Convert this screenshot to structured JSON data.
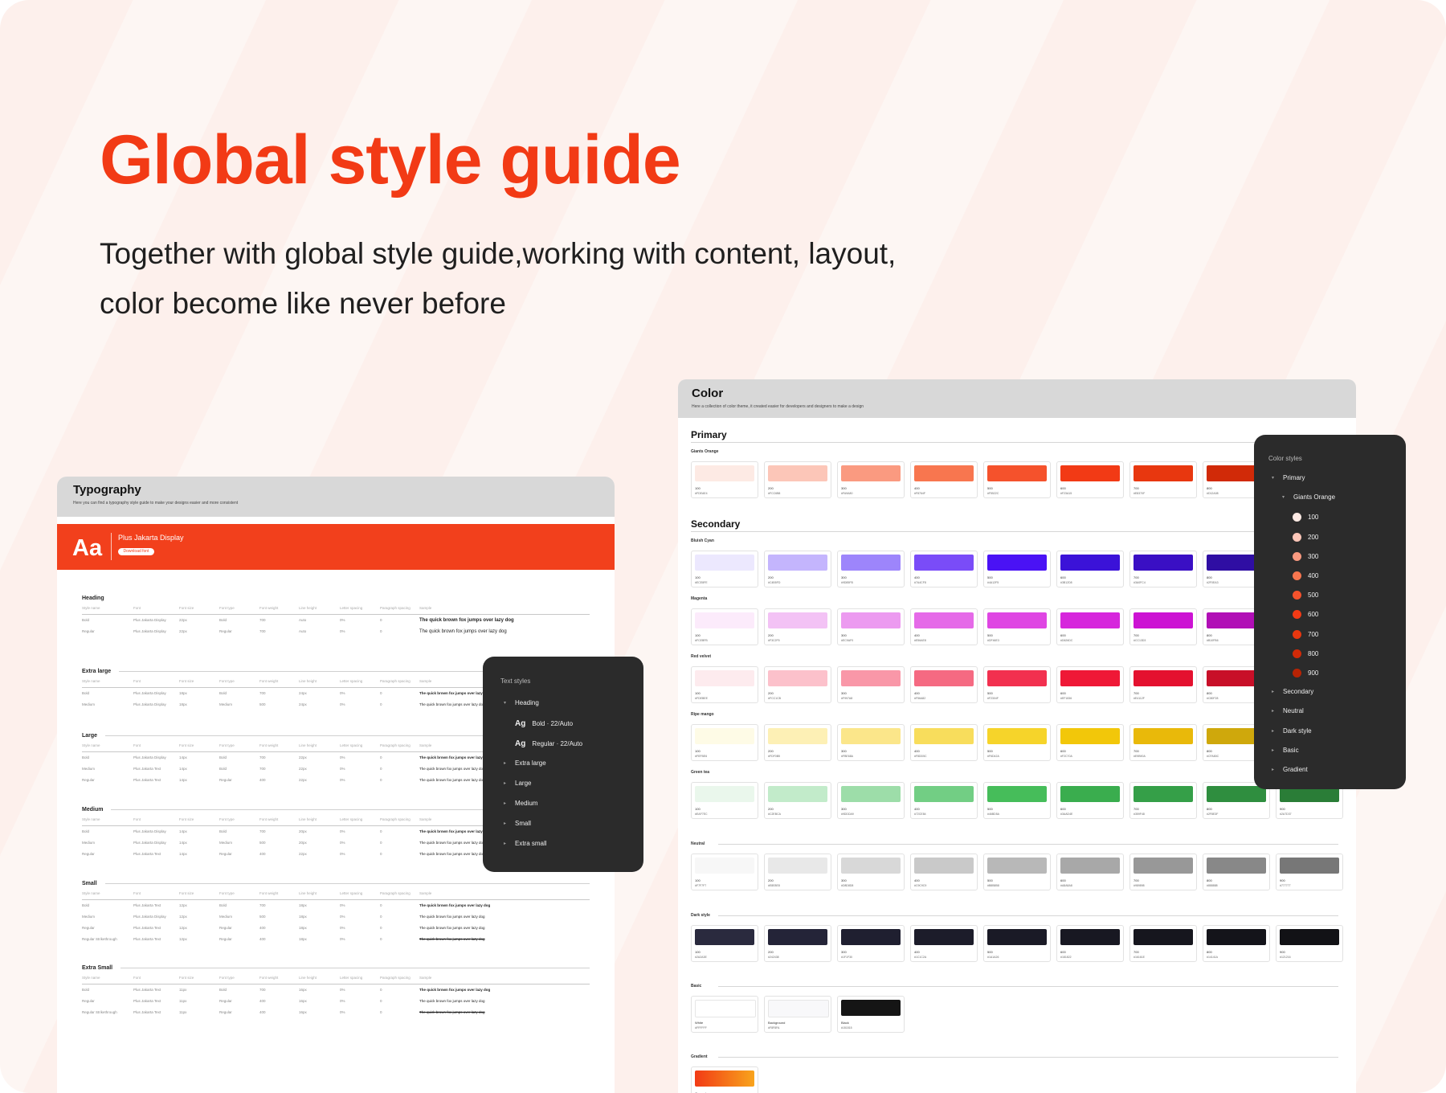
{
  "hero": {
    "title": "Global style guide",
    "subtitle": "Together with global style guide,working with content, layout, color become like never before",
    "title_color": "#f23a15"
  },
  "typography": {
    "title": "Typography",
    "description": "Here you can find a typography style guide to make your designs easier and more consistent",
    "font_sample": "Aa",
    "font_name": "Plus Jakarta Display",
    "download_label": "Download font",
    "columns": [
      "Style name",
      "Font",
      "Font size",
      "Font type",
      "Font weight",
      "Line height",
      "Letter spacing",
      "Paragraph spacing",
      "Sample"
    ],
    "sections": [
      {
        "title": "Heading",
        "rows": [
          [
            "Bold",
            "Plus Jakarta Display",
            "22px",
            "Bold",
            "700",
            "Auto",
            "0%",
            "0",
            "The quick brown fox jumps over lazy dog"
          ],
          [
            "Regular",
            "Plus Jakarta Display",
            "22px",
            "Regular",
            "700",
            "Auto",
            "0%",
            "0",
            "The quick brown fox jumps over lazy dog"
          ]
        ]
      },
      {
        "title": "Extra large",
        "rows": [
          [
            "Bold",
            "Plus Jakarta Display",
            "18px",
            "Bold",
            "700",
            "24px",
            "0%",
            "0",
            "The quick brown fox jumps over lazy dog"
          ],
          [
            "Medium",
            "Plus Jakarta Display",
            "18px",
            "Medium",
            "500",
            "24px",
            "0%",
            "0",
            "The quick brown fox jumps over lazy dog"
          ]
        ]
      },
      {
        "title": "Large",
        "rows": [
          [
            "Bold",
            "Plus Jakarta Display",
            "14px",
            "Bold",
            "700",
            "22px",
            "0%",
            "0",
            "The quick brown fox jumps over lazy dog"
          ],
          [
            "Medium",
            "Plus Jakarta Text",
            "14px",
            "Bold",
            "700",
            "22px",
            "0%",
            "0",
            "The quick brown fox jumps over lazy dog"
          ],
          [
            "Regular",
            "Plus Jakarta Text",
            "14px",
            "Regular",
            "400",
            "22px",
            "0%",
            "0",
            "The quick brown fox jumps over lazy dog"
          ]
        ]
      },
      {
        "title": "Medium",
        "rows": [
          [
            "Bold",
            "Plus Jakarta Display",
            "14px",
            "Bold",
            "700",
            "20px",
            "0%",
            "0",
            "The quick brown fox jumps over lazy dog"
          ],
          [
            "Medium",
            "Plus Jakarta Display",
            "14px",
            "Medium",
            "500",
            "20px",
            "0%",
            "0",
            "The quick brown fox jumps over lazy dog"
          ],
          [
            "Regular",
            "Plus Jakarta Text",
            "14px",
            "Regular",
            "400",
            "22px",
            "0%",
            "0",
            "The quick brown fox jumps over lazy dog"
          ]
        ]
      },
      {
        "title": "Small",
        "rows": [
          [
            "Bold",
            "Plus Jakarta Text",
            "12px",
            "Bold",
            "700",
            "18px",
            "0%",
            "0",
            "The quick brown fox jumps over lazy dog"
          ],
          [
            "Medium",
            "Plus Jakarta Display",
            "12px",
            "Medium",
            "500",
            "18px",
            "0%",
            "0",
            "The quick brown fox jumps over lazy dog"
          ],
          [
            "Regular",
            "Plus Jakarta Text",
            "12px",
            "Regular",
            "400",
            "18px",
            "0%",
            "0",
            "The quick brown fox jumps over lazy dog"
          ],
          [
            "Regular Strikethrough",
            "Plus Jakarta Text",
            "12px",
            "Regular",
            "400",
            "18px",
            "0%",
            "0",
            "The quick brown fox jumps over lazy dog"
          ]
        ]
      },
      {
        "title": "Extra Small",
        "rows": [
          [
            "Bold",
            "Plus Jakarta Text",
            "11px",
            "Bold",
            "700",
            "16px",
            "0%",
            "0",
            "The quick brown fox jumps over lazy dog"
          ],
          [
            "Regular",
            "Plus Jakarta Text",
            "11px",
            "Regular",
            "400",
            "16px",
            "0%",
            "0",
            "The quick brown fox jumps over lazy dog"
          ],
          [
            "Regular Strikethrough",
            "Plus Jakarta Text",
            "11px",
            "Regular",
            "400",
            "16px",
            "0%",
            "0",
            "The quick brown fox jumps over lazy dog"
          ]
        ]
      }
    ]
  },
  "text_styles": {
    "title": "Text styles",
    "items": [
      {
        "label": "Heading",
        "type": "group-open"
      },
      {
        "label": "Bold · 22/Auto",
        "type": "style"
      },
      {
        "label": "Regular · 22/Auto",
        "type": "style"
      },
      {
        "label": "Extra large",
        "type": "group"
      },
      {
        "label": "Large",
        "type": "group"
      },
      {
        "label": "Medium",
        "type": "group"
      },
      {
        "label": "Small",
        "type": "group"
      },
      {
        "label": "Extra small",
        "type": "group"
      }
    ],
    "glyph": "Ag"
  },
  "color": {
    "title": "Color",
    "description": "Here a collection of color theme, it created easier for developers and designers to make a design",
    "primary_heading": "Primary",
    "secondary_heading": "Secondary",
    "groups": [
      {
        "label": "Giants Orange",
        "steps": [
          "100",
          "200",
          "300",
          "400",
          "500",
          "600",
          "700",
          "800"
        ],
        "colors": [
          "#fdeae4",
          "#fcc6b8",
          "#fa9a80",
          "#f8764f",
          "#f5522c",
          "#f23a15",
          "#e8370f",
          "#d12a08"
        ]
      },
      {
        "label": "Bluish Cyan",
        "steps": [
          "100",
          "200",
          "300",
          "400",
          "500",
          "600",
          "700",
          "800"
        ],
        "colors": [
          "#ece8fe",
          "#c4b5fd",
          "#9d85fb",
          "#7a4cf8",
          "#4a12f5",
          "#3b12d8",
          "#3a0fc4",
          "#2f0ea3"
        ]
      },
      {
        "label": "Magenta",
        "steps": [
          "100",
          "200",
          "300",
          "400",
          "500",
          "600",
          "700",
          "800"
        ],
        "colors": [
          "#fcebfb",
          "#f3c2f5",
          "#ec9af0",
          "#e56ae8",
          "#df46e3",
          "#d626dc",
          "#cc13d3",
          "#b10fb6"
        ]
      },
      {
        "label": "Red velvet",
        "steps": [
          "100",
          "200",
          "300",
          "400",
          "500",
          "600",
          "700",
          "800"
        ],
        "colors": [
          "#fdebee",
          "#fcc1cb",
          "#f997a8",
          "#f56a82",
          "#f2304f",
          "#ef1836",
          "#e4112f",
          "#c80f28"
        ]
      },
      {
        "label": "Ripe mango",
        "steps": [
          "100",
          "200",
          "300",
          "400",
          "500",
          "600",
          "700",
          "800"
        ],
        "colors": [
          "#fefbe6",
          "#fdf0b5",
          "#fbe68a",
          "#f8dd5c",
          "#f6d42a",
          "#f2c70a",
          "#e9b90a",
          "#cfa80c"
        ]
      },
      {
        "label": "Green tea",
        "steps": [
          "100",
          "200",
          "300",
          "400",
          "500",
          "600",
          "700",
          "800",
          "900"
        ],
        "colors": [
          "#eaf7ec",
          "#c2ebca",
          "#9ddda9",
          "#72ce84",
          "#46bd5a",
          "#3aad4e",
          "#359f48",
          "#2f8e3f",
          "#2a7d37"
        ]
      },
      {
        "label": "Neutral",
        "steps": [
          "100",
          "200",
          "300",
          "400",
          "500",
          "600",
          "700",
          "800",
          "900"
        ],
        "colors": [
          "#f7f7f7",
          "#e8e8e8",
          "#d8d8d8",
          "#c9c9c9",
          "#b8b8b8",
          "#a8a8a8",
          "#989898",
          "#888888",
          "#777777"
        ]
      },
      {
        "label": "Dark style",
        "steps": [
          "100",
          "200",
          "300",
          "400",
          "500",
          "600",
          "700",
          "800",
          "900"
        ],
        "colors": [
          "#2a2a3e",
          "#242438",
          "#1f1f30",
          "#1c1c2a",
          "#1a1a26",
          "#181822",
          "#16161e",
          "#14141a",
          "#121216"
        ]
      },
      {
        "label": "Basic",
        "steps": [
          "White",
          "Background",
          "Black"
        ],
        "colors": [
          "#ffffff",
          "#f8f8fa",
          "#151515"
        ]
      },
      {
        "label": "Gradient",
        "steps": [
          "Orangeburn"
        ],
        "colors": [
          "#f23a15"
        ]
      }
    ],
    "gradient": {
      "from": "#f23a15",
      "to": "#f8a41c"
    }
  },
  "color_styles": {
    "title": "Color styles",
    "items": [
      {
        "label": "Primary",
        "level": 0,
        "type": "group-open"
      },
      {
        "label": "Giants Orange",
        "level": 1,
        "type": "group-open"
      },
      {
        "label": "100",
        "level": 2,
        "type": "swatch",
        "color": "#fdeae4"
      },
      {
        "label": "200",
        "level": 2,
        "type": "swatch",
        "color": "#fcc6b8"
      },
      {
        "label": "300",
        "level": 2,
        "type": "swatch",
        "color": "#fa9a80"
      },
      {
        "label": "400",
        "level": 2,
        "type": "swatch",
        "color": "#f8764f"
      },
      {
        "label": "500",
        "level": 2,
        "type": "swatch",
        "color": "#f5522c"
      },
      {
        "label": "600",
        "level": 2,
        "type": "swatch",
        "color": "#f23a15"
      },
      {
        "label": "700",
        "level": 2,
        "type": "swatch",
        "color": "#e8370f"
      },
      {
        "label": "800",
        "level": 2,
        "type": "swatch",
        "color": "#d12a08"
      },
      {
        "label": "900",
        "level": 2,
        "type": "swatch",
        "color": "#b82304"
      },
      {
        "label": "Secondary",
        "level": 0,
        "type": "group"
      },
      {
        "label": "Neutral",
        "level": 0,
        "type": "group"
      },
      {
        "label": "Dark style",
        "level": 0,
        "type": "group"
      },
      {
        "label": "Basic",
        "level": 0,
        "type": "group"
      },
      {
        "label": "Gradient",
        "level": 0,
        "type": "group"
      }
    ]
  }
}
